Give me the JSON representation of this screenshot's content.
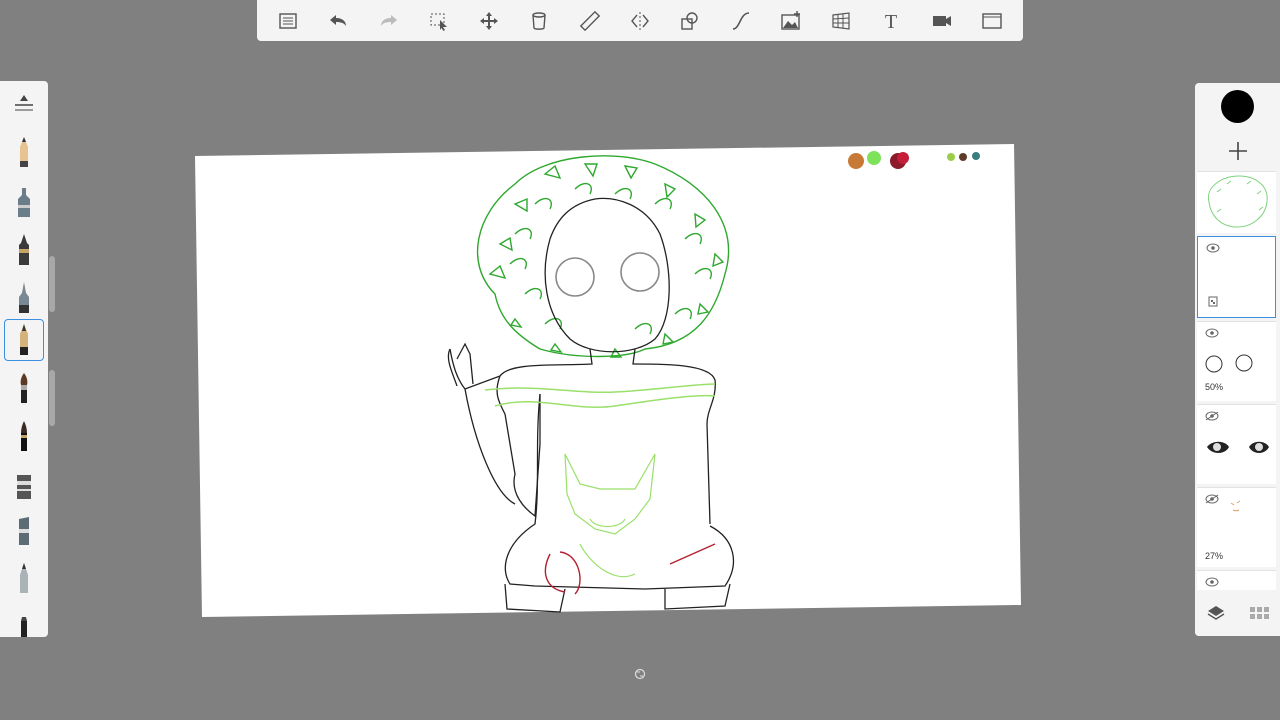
{
  "toolbar": {
    "items": [
      {
        "name": "menu",
        "icon": "list-icon"
      },
      {
        "name": "undo",
        "icon": "undo-arrow-icon"
      },
      {
        "name": "redo",
        "icon": "redo-arrow-icon"
      },
      {
        "name": "select",
        "icon": "selection-icon"
      },
      {
        "name": "transform",
        "icon": "move-arrows-icon"
      },
      {
        "name": "fill",
        "icon": "bucket-icon"
      },
      {
        "name": "ruler",
        "icon": "ruler-icon"
      },
      {
        "name": "symmetry",
        "icon": "symmetry-icon"
      },
      {
        "name": "shapes",
        "icon": "shapes-icon"
      },
      {
        "name": "stroke",
        "icon": "curve-icon"
      },
      {
        "name": "image",
        "icon": "image-icon"
      },
      {
        "name": "perspective",
        "icon": "perspective-grid-icon"
      },
      {
        "name": "text",
        "icon": "text-icon",
        "label": "T"
      },
      {
        "name": "timelapse",
        "icon": "video-camera-icon"
      },
      {
        "name": "fullscreen",
        "icon": "frame-icon"
      }
    ]
  },
  "brushes": {
    "selected_index": 5,
    "items": [
      "settings-slider-icon",
      "pencil-icon",
      "marker-icon",
      "ink-pen-icon",
      "technical-pen-icon",
      "fountain-pen-icon",
      "paintbrush-icon",
      "brush-pen-icon",
      "flat-marker-icon",
      "chisel-marker-icon",
      "airbrush-icon",
      "felt-tip-icon"
    ]
  },
  "canvas": {
    "background": "#ffffff",
    "hair_color": "#2ea82e",
    "shirt_line_color": "#9ae06a",
    "palette": [
      "#c77a35",
      "#7ee35a",
      "#8b1a2b",
      "#c41e3a",
      "#9ccd4a",
      "#5e3b2b",
      "#3a7d7d"
    ]
  },
  "panel": {
    "current_color": "#000000",
    "layers": [
      {
        "name": "hair-layer",
        "visible": true,
        "opacity": ""
      },
      {
        "name": "empty-layer",
        "visible": true,
        "opacity": "",
        "selected": true
      },
      {
        "name": "eye-circles-layer",
        "visible": true,
        "opacity": "50%"
      },
      {
        "name": "eyes-layer",
        "visible": false,
        "opacity": ""
      },
      {
        "name": "face-layer",
        "visible": false,
        "opacity": "27%"
      },
      {
        "name": "next-layer",
        "visible": true,
        "opacity": ""
      }
    ]
  }
}
